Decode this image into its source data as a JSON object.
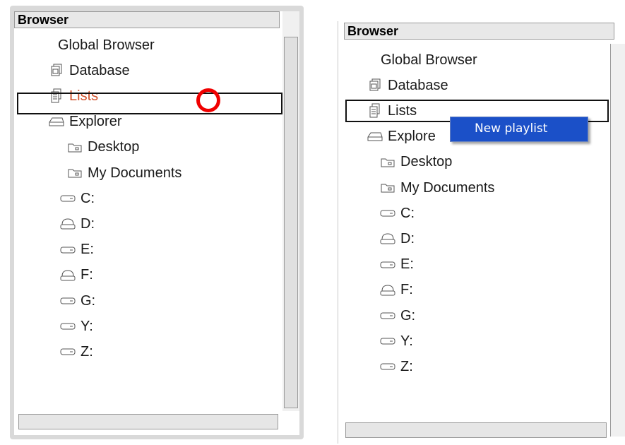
{
  "left": {
    "header": "Browser",
    "items": [
      {
        "label": "Global Browser",
        "icon": "none",
        "selected": false
      },
      {
        "label": "Database",
        "icon": "database-icon",
        "selected": false
      },
      {
        "label": "Lists",
        "icon": "lists-icon",
        "selected": true,
        "color": "#d0502a"
      },
      {
        "label": "Explorer",
        "icon": "drive-tray-icon",
        "selected": false
      },
      {
        "label": "Desktop",
        "icon": "folder-icon",
        "selected": false
      },
      {
        "label": "My Documents",
        "icon": "folder-icon",
        "selected": false
      },
      {
        "label": "C:",
        "icon": "hard-drive-icon",
        "selected": false
      },
      {
        "label": "D:",
        "icon": "optical-drive-icon",
        "selected": false
      },
      {
        "label": "E:",
        "icon": "hard-drive-icon",
        "selected": false
      },
      {
        "label": "F:",
        "icon": "optical-drive-icon",
        "selected": false
      },
      {
        "label": "G:",
        "icon": "hard-drive-icon",
        "selected": false
      },
      {
        "label": "Y:",
        "icon": "hard-drive-icon",
        "selected": false
      },
      {
        "label": "Z:",
        "icon": "hard-drive-icon",
        "selected": false
      }
    ],
    "highlight_color": "#f00000"
  },
  "right": {
    "header": "Browser",
    "items": [
      {
        "label": "Global Browser",
        "icon": "none"
      },
      {
        "label": "Database",
        "icon": "database-icon"
      },
      {
        "label": "Lists",
        "icon": "lists-icon"
      },
      {
        "label": "Explore",
        "icon": "drive-tray-icon"
      },
      {
        "label": "Desktop",
        "icon": "folder-icon"
      },
      {
        "label": "My Documents",
        "icon": "folder-icon"
      },
      {
        "label": "C:",
        "icon": "hard-drive-icon"
      },
      {
        "label": "D:",
        "icon": "optical-drive-icon"
      },
      {
        "label": "E:",
        "icon": "hard-drive-icon"
      },
      {
        "label": "F:",
        "icon": "optical-drive-icon"
      },
      {
        "label": "G:",
        "icon": "hard-drive-icon"
      },
      {
        "label": "Y:",
        "icon": "hard-drive-icon"
      },
      {
        "label": "Z:",
        "icon": "hard-drive-icon"
      }
    ],
    "context_menu": {
      "items": [
        {
          "label": "New playlist"
        }
      ],
      "background": "#1b50c8"
    }
  }
}
